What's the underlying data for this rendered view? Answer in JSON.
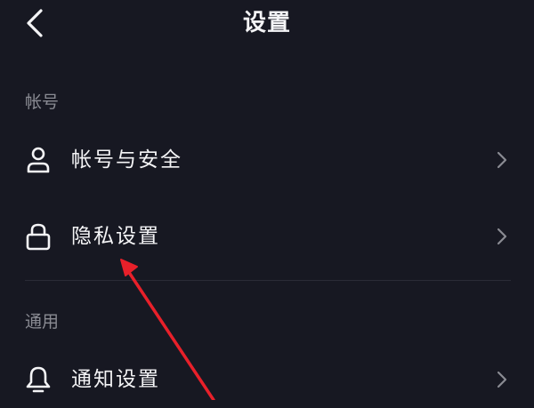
{
  "header": {
    "title": "设置",
    "back_icon": "chevron-left-icon"
  },
  "sections": [
    {
      "title": "帐号",
      "items": [
        {
          "label": "帐号与安全",
          "icon": "user-icon"
        },
        {
          "label": "隐私设置",
          "icon": "lock-icon"
        }
      ]
    },
    {
      "title": "通用",
      "items": [
        {
          "label": "通知设置",
          "icon": "bell-icon"
        }
      ]
    }
  ],
  "colors": {
    "background": "#171822",
    "text": "#f4f4f6",
    "section_header": "#8a8b93",
    "chevron": "#8a8b93",
    "divider": "#2a2b36",
    "annotation_arrow": "#e8202a"
  }
}
